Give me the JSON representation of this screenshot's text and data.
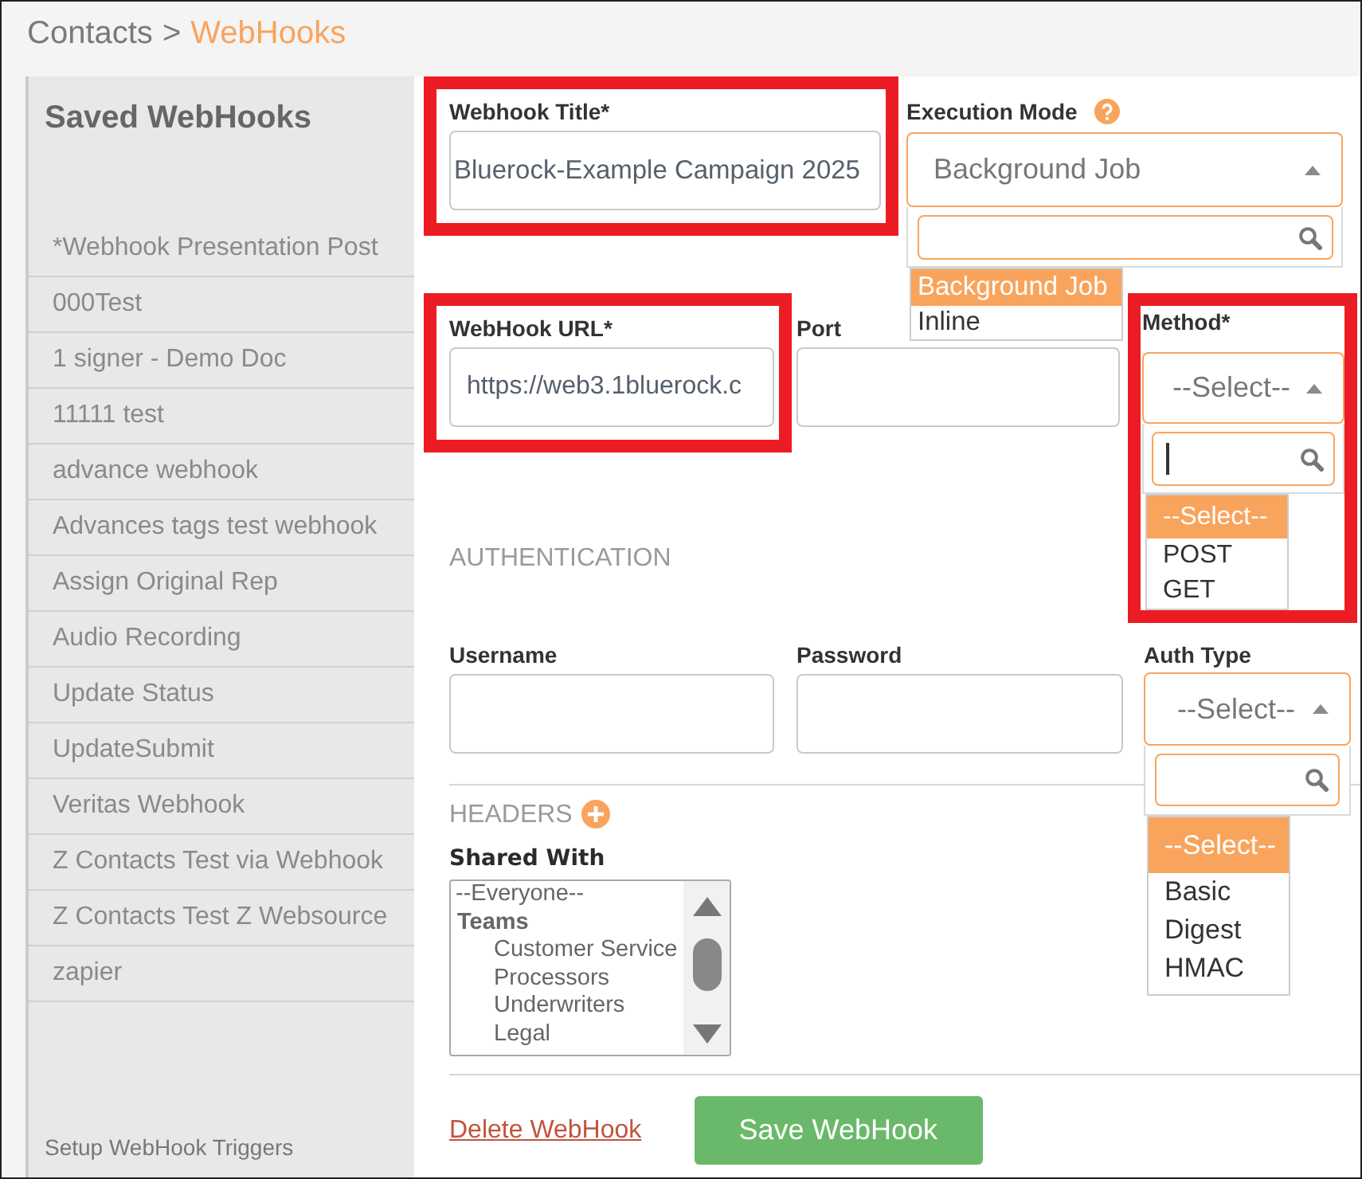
{
  "breadcrumb": {
    "items": [
      {
        "label": "Contacts",
        "current": false
      },
      {
        "label": "WebHooks",
        "current": true
      }
    ],
    "separator": ">"
  },
  "sidebar": {
    "title": "Saved WebHooks",
    "items": [
      {
        "label": "*Webhook Presentation Post",
        "selected": false
      },
      {
        "label": "000Test",
        "selected": false
      },
      {
        "label": "1 signer - Demo Doc",
        "selected": false
      },
      {
        "label": "11111 test",
        "selected": false
      },
      {
        "label": "advance webhook",
        "selected": false
      },
      {
        "label": "Advances tags test webhook",
        "selected": false
      },
      {
        "label": "Assign Original Rep",
        "selected": false
      },
      {
        "label": "Audio Recording",
        "selected": false
      },
      {
        "label": "Update Status",
        "selected": false
      },
      {
        "label": "UpdateSubmit",
        "selected": false
      },
      {
        "label": "Veritas Webhook",
        "selected": false
      },
      {
        "label": "Z Contacts Test via Webhook",
        "selected": false
      },
      {
        "label": "Z Contacts Test Z Websource",
        "selected": false
      },
      {
        "label": "zapier",
        "selected": false
      }
    ],
    "footer_link": "Setup WebHook Triggers"
  },
  "webhook_title": {
    "label": "Webhook Title*",
    "value": "Bluerock-Example Campaign 2025",
    "highlighted": true
  },
  "execution_mode": {
    "label": "Execution Mode",
    "help": true,
    "value": "Background Job",
    "open": true,
    "search_focused": false,
    "options": [
      {
        "label": "Background Job",
        "selected": true
      },
      {
        "label": "Inline",
        "selected": false
      }
    ]
  },
  "webhook_url": {
    "label": "WebHook URL*",
    "value": "https://web3.1bluerock.c",
    "highlighted": true
  },
  "port": {
    "label": "Port"
  },
  "method": {
    "label": "Method*",
    "value": "--Select--",
    "open": true,
    "search_focused": true,
    "highlighted": true,
    "options": [
      {
        "label": "--Select--",
        "selected": true
      },
      {
        "label": "POST",
        "selected": false
      },
      {
        "label": "GET",
        "selected": false
      }
    ]
  },
  "authentication": {
    "heading": "AUTHENTICATION",
    "username": {
      "label": "Username"
    },
    "password": {
      "label": "Password"
    },
    "auth_type": {
      "label": "Auth Type",
      "value": "--Select--",
      "open": true,
      "search_focused": false,
      "options": [
        {
          "label": "--Select--",
          "selected": true
        },
        {
          "label": "Basic",
          "selected": false
        },
        {
          "label": "Digest",
          "selected": false
        },
        {
          "label": "HMAC",
          "selected": false
        }
      ]
    }
  },
  "headers": {
    "heading": "HEADERS"
  },
  "shared_with": {
    "label": "Shared With",
    "options": [
      {
        "kind": "option",
        "label": "--Everyone--",
        "selected": false
      },
      {
        "kind": "group",
        "label": "Teams",
        "children": [
          {
            "label": "Customer Service",
            "selected": false
          },
          {
            "label": "Processors",
            "selected": false
          },
          {
            "label": "Underwriters",
            "selected": false
          },
          {
            "label": "Legal",
            "selected": false
          }
        ]
      }
    ]
  },
  "actions": {
    "delete_link": "Delete WebHook",
    "save_button": "Save WebHook"
  }
}
